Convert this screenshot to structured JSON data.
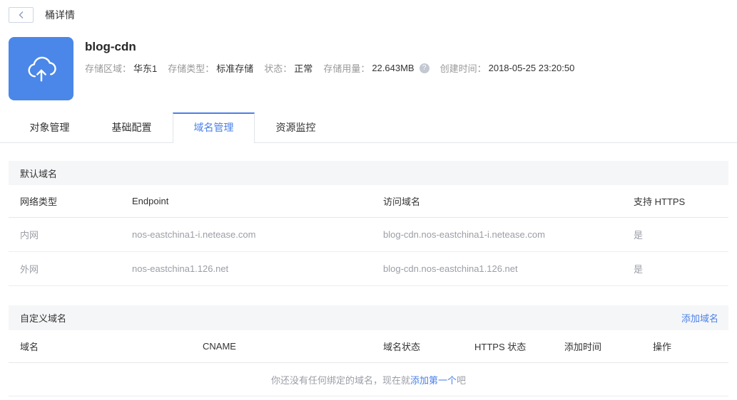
{
  "page": {
    "title": "桶详情"
  },
  "icons": {
    "help_glyph": "?"
  },
  "colors": {
    "accent": "#4b80e8",
    "icon_bg": "#4a87e8"
  },
  "bucket": {
    "name": "blog-cdn",
    "meta": [
      {
        "label": "存储区域：",
        "value": "华东1"
      },
      {
        "label": "存储类型：",
        "value": "标准存储"
      },
      {
        "label": "状态：",
        "value": "正常"
      },
      {
        "label": "存储用量：",
        "value": "22.643MB"
      },
      {
        "label": "创建时间：",
        "value": "2018-05-25 23:20:50"
      }
    ]
  },
  "tabs": [
    {
      "label": "对象管理",
      "active": false
    },
    {
      "label": "基础配置",
      "active": false
    },
    {
      "label": "域名管理",
      "active": true
    },
    {
      "label": "资源监控",
      "active": false
    }
  ],
  "default_domain": {
    "section_title": "默认域名",
    "columns": [
      "网络类型",
      "Endpoint",
      "访问域名",
      "支持 HTTPS"
    ],
    "rows": [
      [
        "内网",
        "nos-eastchina1-i.netease.com",
        "blog-cdn.nos-eastchina1-i.netease.com",
        "是"
      ],
      [
        "外网",
        "nos-eastchina1.126.net",
        "blog-cdn.nos-eastchina1.126.net",
        "是"
      ]
    ]
  },
  "custom_domain": {
    "section_title": "自定义域名",
    "add_link": "添加域名",
    "columns": [
      "域名",
      "CNAME",
      "域名状态",
      "HTTPS 状态",
      "添加时间",
      "操作"
    ],
    "empty_state": {
      "prefix": "你还没有任何绑定的域名，现在就",
      "link": "添加第一个",
      "suffix": "吧"
    }
  }
}
